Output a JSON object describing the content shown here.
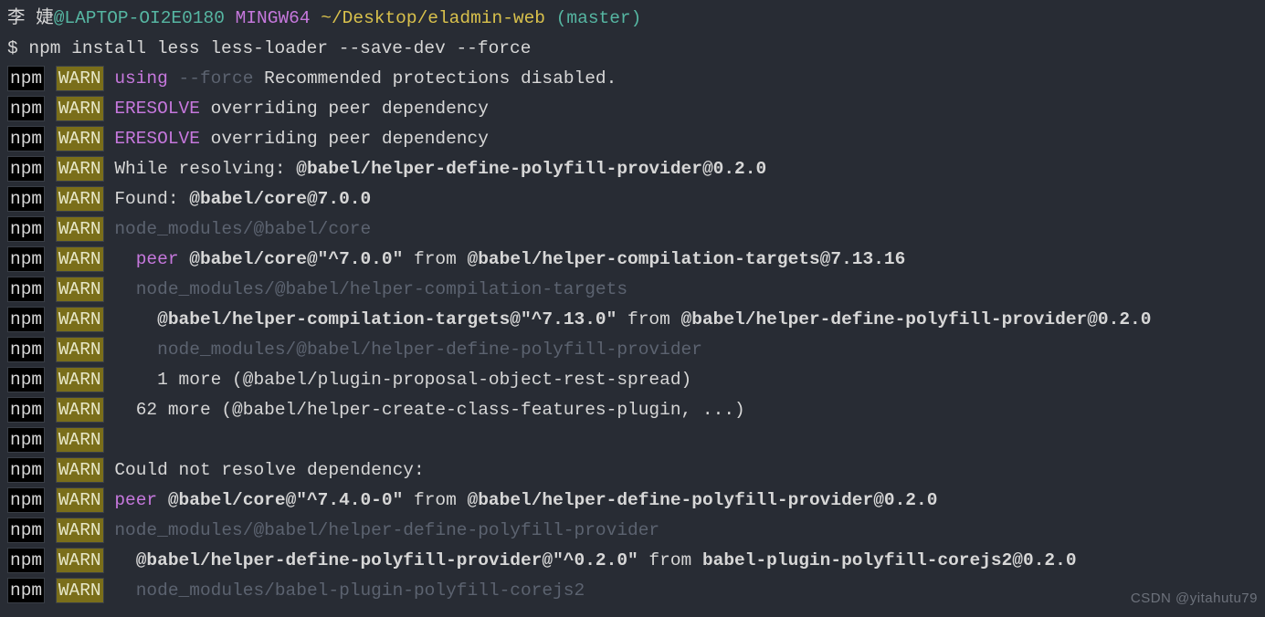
{
  "prompt": {
    "user": "李 婕",
    "host": "@LAPTOP-OI2E0180",
    "env": " MINGW64",
    "path": " ~/Desktop/eladmin-web",
    "branch": " (master)"
  },
  "cmd": "$ npm install less less-loader --save-dev --force",
  "tags": {
    "npm": "npm",
    "warn": "WARN"
  },
  "lines": [
    {
      "segments": [
        {
          "t": "using",
          "cls": "purple"
        },
        {
          "t": " ",
          "cls": ""
        },
        {
          "t": "--force",
          "cls": "dim"
        },
        {
          "t": " Recommended protections disabled.",
          "cls": "white"
        }
      ]
    },
    {
      "segments": [
        {
          "t": "ERESOLVE",
          "cls": "purple"
        },
        {
          "t": " overriding peer dependency",
          "cls": "white"
        }
      ]
    },
    {
      "segments": [
        {
          "t": "ERESOLVE",
          "cls": "purple"
        },
        {
          "t": " overriding peer dependency",
          "cls": "white"
        }
      ]
    },
    {
      "segments": [
        {
          "t": "While resolving: ",
          "cls": "white"
        },
        {
          "t": "@babel/helper-define-polyfill-provider@0.2.0",
          "cls": "white bold"
        }
      ]
    },
    {
      "segments": [
        {
          "t": "Found: ",
          "cls": "white"
        },
        {
          "t": "@babel/core@7.0.0",
          "cls": "white bold"
        }
      ]
    },
    {
      "segments": [
        {
          "t": "node_modules/@babel/core",
          "cls": "dim"
        }
      ]
    },
    {
      "segments": [
        {
          "t": "  ",
          "cls": ""
        },
        {
          "t": "peer",
          "cls": "purple"
        },
        {
          "t": " ",
          "cls": ""
        },
        {
          "t": "@babel/core@\"^7.0.0\"",
          "cls": "white bold"
        },
        {
          "t": " from ",
          "cls": "white"
        },
        {
          "t": "@babel/helper-compilation-targets@7.13.16",
          "cls": "white bold"
        }
      ]
    },
    {
      "segments": [
        {
          "t": "  node_modules/@babel/helper-compilation-targets",
          "cls": "dim"
        }
      ]
    },
    {
      "segments": [
        {
          "t": "    ",
          "cls": ""
        },
        {
          "t": "@babel/helper-compilation-targets@\"^7.13.0\"",
          "cls": "white bold"
        },
        {
          "t": " from ",
          "cls": "white"
        },
        {
          "t": "@babel/helper-define-polyfill-provider@0.2.0",
          "cls": "white bold"
        }
      ]
    },
    {
      "segments": [
        {
          "t": "    node_modules/@babel/helper-define-polyfill-provider",
          "cls": "dim"
        }
      ]
    },
    {
      "segments": [
        {
          "t": "    1 more (@babel/plugin-proposal-object-rest-spread)",
          "cls": "white"
        }
      ]
    },
    {
      "segments": [
        {
          "t": "  62 more (@babel/helper-create-class-features-plugin, ...)",
          "cls": "white"
        }
      ]
    },
    {
      "segments": []
    },
    {
      "segments": [
        {
          "t": "Could not resolve dependency:",
          "cls": "white"
        }
      ]
    },
    {
      "segments": [
        {
          "t": "peer",
          "cls": "purple"
        },
        {
          "t": " ",
          "cls": ""
        },
        {
          "t": "@babel/core@\"^7.4.0-0\"",
          "cls": "white bold"
        },
        {
          "t": " from ",
          "cls": "white"
        },
        {
          "t": "@babel/helper-define-polyfill-provider@0.2.0",
          "cls": "white bold"
        }
      ]
    },
    {
      "segments": [
        {
          "t": "node_modules/@babel/helper-define-polyfill-provider",
          "cls": "dim"
        }
      ]
    },
    {
      "segments": [
        {
          "t": "  ",
          "cls": ""
        },
        {
          "t": "@babel/helper-define-polyfill-provider@\"^0.2.0\"",
          "cls": "white bold"
        },
        {
          "t": " from ",
          "cls": "white"
        },
        {
          "t": "babel-plugin-polyfill-corejs2@0.2.0",
          "cls": "white bold"
        }
      ]
    },
    {
      "segments": [
        {
          "t": "  node_modules/babel-plugin-polyfill-corejs2",
          "cls": "dim"
        }
      ]
    }
  ],
  "watermark": "CSDN @yitahutu79"
}
